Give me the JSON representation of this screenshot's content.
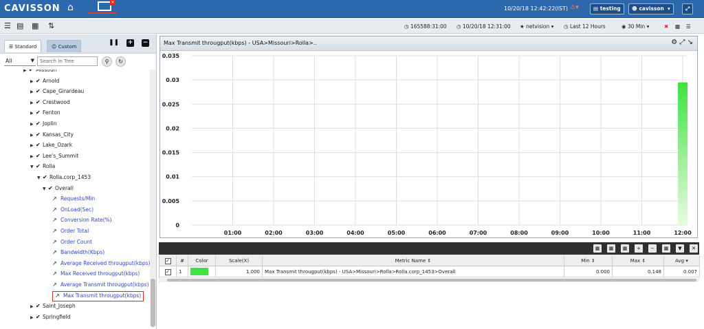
{
  "topbar": {
    "logo": "CAVISSON",
    "datetime": "10/20/18 12:42:22(IST)",
    "project_btn": "testing",
    "user_btn": "cavisson"
  },
  "toolbar": {
    "session_id": "165588:31:00",
    "start_time": "10/20/18 12:31:00",
    "profile": "netvision",
    "preset": "Last 12 Hours",
    "interval": "30 Min"
  },
  "left_panel": {
    "tab_standard": "Standard",
    "tab_custom": "Custom",
    "filter_value": "All",
    "search_placeholder": "Search In Tree",
    "tree": [
      {
        "label": "Missouri",
        "indent": 0,
        "type": "folder"
      },
      {
        "label": "Arnold",
        "indent": 1,
        "type": "folder"
      },
      {
        "label": "Cape_Girardeau",
        "indent": 1,
        "type": "folder"
      },
      {
        "label": "Crestwood",
        "indent": 1,
        "type": "folder"
      },
      {
        "label": "Fenton",
        "indent": 1,
        "type": "folder"
      },
      {
        "label": "Joplin",
        "indent": 1,
        "type": "folder"
      },
      {
        "label": "Kansas_City",
        "indent": 1,
        "type": "folder"
      },
      {
        "label": "Lake_Ozark",
        "indent": 1,
        "type": "folder"
      },
      {
        "label": "Lee's_Summit",
        "indent": 1,
        "type": "folder"
      },
      {
        "label": "Rolla",
        "indent": 1,
        "type": "folder-open"
      },
      {
        "label": "Rolla.corp_1453",
        "indent": 2,
        "type": "folder-open"
      },
      {
        "label": "Overall",
        "indent": 3,
        "type": "folder-open"
      },
      {
        "label": "Requests/Min",
        "indent": 4,
        "type": "leaf"
      },
      {
        "label": "OnLoad(Sec)",
        "indent": 4,
        "type": "leaf"
      },
      {
        "label": "Conversion Rate(%)",
        "indent": 4,
        "type": "leaf"
      },
      {
        "label": "Order Total",
        "indent": 4,
        "type": "leaf"
      },
      {
        "label": "Order Count",
        "indent": 4,
        "type": "leaf"
      },
      {
        "label": "Bandwidth(Kbps)",
        "indent": 4,
        "type": "leaf"
      },
      {
        "label": "Average Received througput(kbps)",
        "indent": 4,
        "type": "leaf"
      },
      {
        "label": "Max Received througput(kbps)",
        "indent": 4,
        "type": "leaf"
      },
      {
        "label": "Average Transmit througput(kbps)",
        "indent": 4,
        "type": "leaf"
      },
      {
        "label": "Max Transmit througput(kbps)",
        "indent": 4,
        "type": "leaf-selected"
      },
      {
        "label": "Saint_Joseph",
        "indent": 1,
        "type": "folder"
      },
      {
        "label": "Springfield",
        "indent": 1,
        "type": "folder"
      }
    ]
  },
  "chart_data": {
    "type": "bar",
    "title": "Max Transmit througput(kbps) - USA>Missouri>Rolla>..",
    "categories": [
      "01:00",
      "02:00",
      "03:00",
      "04:00",
      "05:00",
      "06:00",
      "07:00",
      "08:00",
      "09:00",
      "10:00",
      "11:00",
      "12:00"
    ],
    "series": [
      {
        "values": [
          0,
          0,
          0,
          0,
          0,
          0,
          0,
          0,
          0,
          0,
          0,
          0.0295
        ]
      }
    ],
    "y_ticks": [
      0,
      0.005,
      0.01,
      0.015,
      0.02,
      0.025,
      0.03,
      0.035
    ],
    "y_tick_labels": [
      "0",
      "0.005",
      "0.01",
      "0.015",
      "0.02",
      "0.025",
      "0.03",
      "0.035"
    ],
    "ylim": [
      0,
      0.035
    ],
    "grid": true,
    "bar_color": "#3fe23f"
  },
  "table": {
    "headers": {
      "num": "#",
      "color": "Color",
      "scale": "Scale(X)",
      "metric": "Metric Name",
      "min": "Min",
      "max": "Max",
      "avg": "Avg"
    },
    "rows": [
      {
        "num": "1",
        "color": "#3fe23f",
        "scale": "1.000",
        "metric": "Max Transmit througput(kbps) - USA>Missouri>Rolla>Rolla.corp_1453>Overall",
        "min": "0.000",
        "max": "0.148",
        "avg": "0.007"
      }
    ]
  }
}
